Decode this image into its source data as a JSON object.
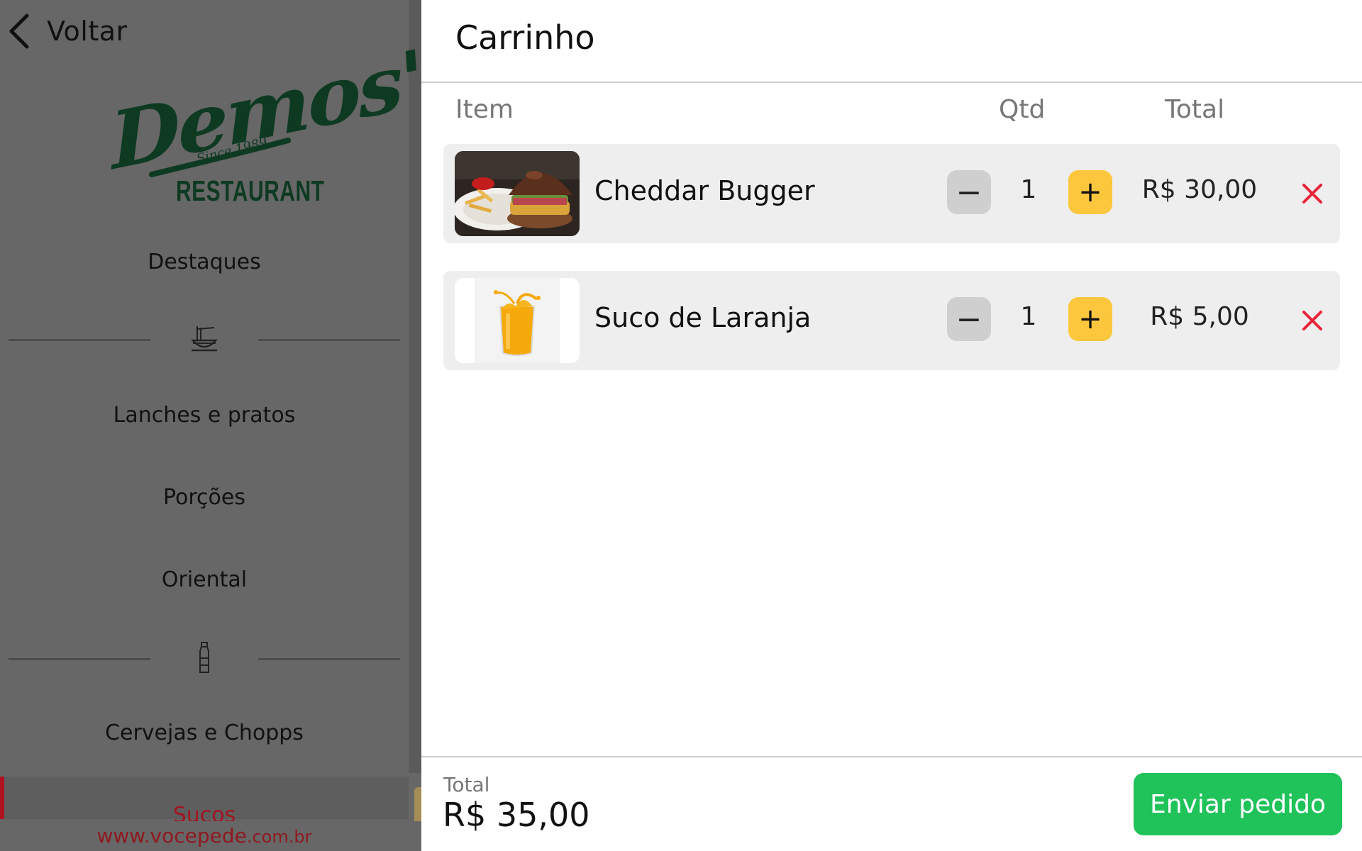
{
  "sidebar": {
    "back_label": "Voltar",
    "logo": {
      "script": "Demos'",
      "since": "Since 1989",
      "subtitle": "RESTAURANT"
    },
    "categories": [
      {
        "label": "Destaques"
      },
      {
        "label": "Lanches e pratos"
      },
      {
        "label": "Porções"
      },
      {
        "label": "Oriental"
      },
      {
        "label": "Cervejas e Chopps"
      },
      {
        "label": "Sucos",
        "selected": true
      }
    ],
    "dividers": [
      {
        "icon": "noodles-icon"
      },
      {
        "icon": "bottle-icon"
      }
    ],
    "site_url_main": "www.vocepede",
    "site_url_suffix": ".com.br"
  },
  "cart": {
    "title": "Carrinho",
    "columns": {
      "item": "Item",
      "qty": "Qtd",
      "total": "Total"
    },
    "items": [
      {
        "name": "Cheddar Bugger",
        "qty": "1",
        "price": "R$ 30,00",
        "image": "burger-photo"
      },
      {
        "name": "Suco de Laranja",
        "qty": "1",
        "price": "R$ 5,00",
        "image": "orange-juice-photo"
      }
    ],
    "decrement_symbol": "−",
    "increment_symbol": "+",
    "footer": {
      "total_label": "Total",
      "total_value": "R$ 35,00",
      "send_label": "Enviar pedido"
    }
  },
  "colors": {
    "accent_yellow": "#fcc73c",
    "send_green": "#20c25a",
    "delete_red": "#e8233a",
    "overlay_gray": "#676767",
    "brand_green": "#0e3a22",
    "selected_red": "#a11522"
  }
}
